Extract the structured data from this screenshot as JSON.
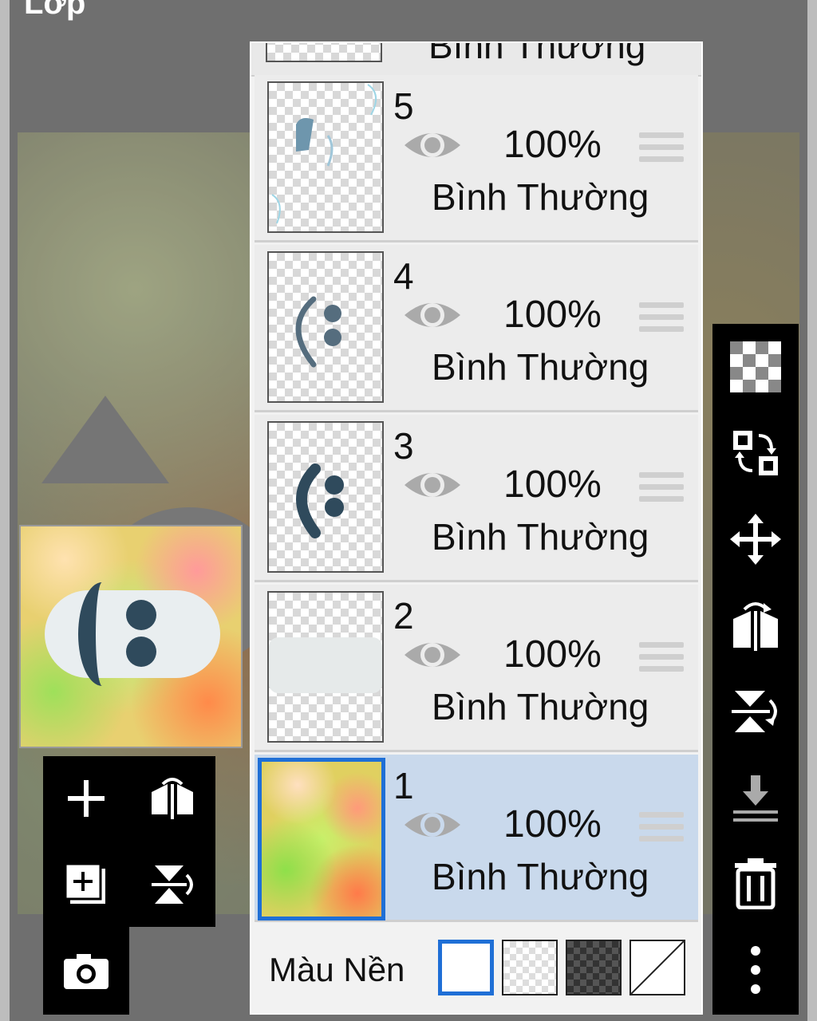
{
  "title": "Lớp",
  "top_layer_blend": "Bình Thường",
  "layers": [
    {
      "num": "5",
      "opacity": "100%",
      "blend": "Bình Thường"
    },
    {
      "num": "4",
      "opacity": "100%",
      "blend": "Bình Thường"
    },
    {
      "num": "3",
      "opacity": "100%",
      "blend": "Bình Thường"
    },
    {
      "num": "2",
      "opacity": "100%",
      "blend": "Bình Thường"
    },
    {
      "num": "1",
      "opacity": "100%",
      "blend": "Bình Thường",
      "selected": true
    }
  ],
  "background": {
    "label": "Màu Nền",
    "options": [
      "white",
      "transparent-light",
      "transparent-dark",
      "none"
    ],
    "selected": "white"
  },
  "left_toolbar": [
    "add-layer-icon",
    "flip-horizontal-icon",
    "add-layer-copy-icon",
    "flip-vertical-icon",
    "camera-icon"
  ],
  "right_toolbar": [
    "transparency-icon",
    "swap-layer-icon",
    "move-icon",
    "flip-horizontal-icon",
    "flip-vertical-icon",
    "merge-down-icon",
    "trash-icon",
    "more-icon"
  ],
  "colors": {
    "selected_layer": "#c9d9ec",
    "selected_border": "#1f6fd6",
    "toolbar": "#000000"
  }
}
